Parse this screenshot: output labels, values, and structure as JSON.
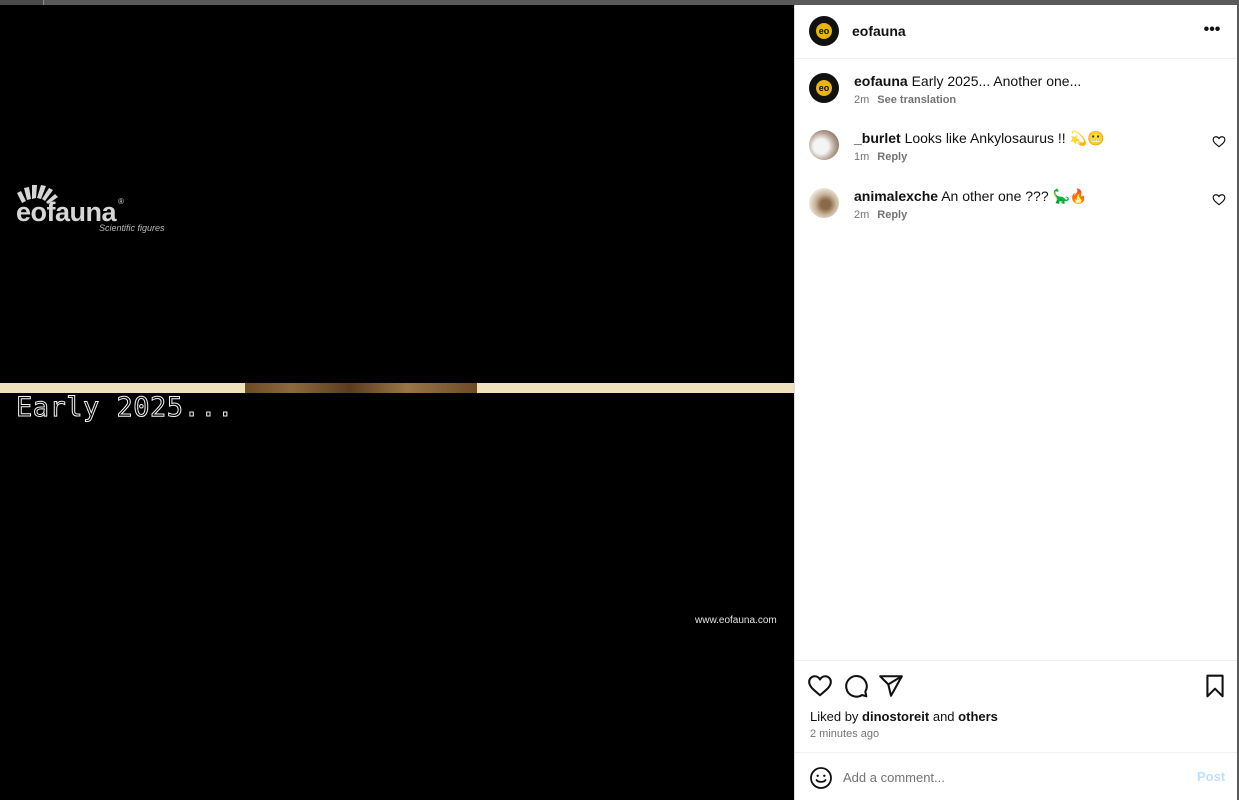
{
  "media": {
    "brand_name": "eofauna",
    "brand_tagline": "Scientific figures",
    "headline": "Early 2025...",
    "website": "www.eofauna.com"
  },
  "header": {
    "username": "eofauna",
    "avatar_text": "eo",
    "more_label": "•••"
  },
  "caption": {
    "username": "eofauna",
    "text": "Early 2025... Another one...",
    "time": "2m",
    "action": "See translation"
  },
  "comments": [
    {
      "username": "_burlet",
      "text": "Looks like Ankylosaurus !!",
      "emoji": "💫😬",
      "time": "1m",
      "action": "Reply"
    },
    {
      "username": "animalexche",
      "text": "An other one ???",
      "emoji": "🦕🔥",
      "time": "2m",
      "action": "Reply"
    }
  ],
  "icons": {
    "like": "heart-icon",
    "comment": "comment-bubble-icon",
    "share": "send-icon",
    "save": "bookmark-icon",
    "emoji": "emoji-icon",
    "more": "more-horizontal-icon"
  },
  "likes": {
    "prefix": "Liked by",
    "user": "dinostoreit",
    "joiner": "and",
    "others": "others",
    "time": "2 minutes ago"
  },
  "composer": {
    "placeholder": "Add a comment...",
    "post_label": "Post"
  },
  "colors": {
    "accent_disabled": "#c0dffd",
    "brand_gold": "#e8b410",
    "muted_text": "#737373"
  }
}
